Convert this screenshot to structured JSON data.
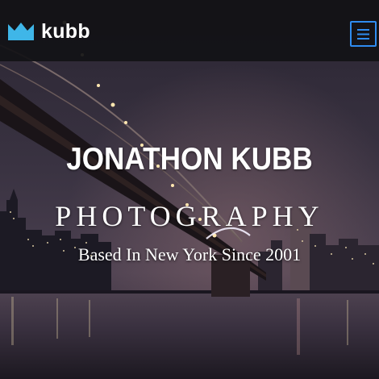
{
  "navbar": {
    "brand_name": "kubb",
    "brand_icon": "crown-icon",
    "menu_icon": "hamburger-menu-icon"
  },
  "hero": {
    "title": "JONATHON KUBB",
    "subtitle": "PHOTOGRAPHY",
    "tagline": "Based In New York Since 2001",
    "background": "night-city-bridge-photo"
  },
  "colors": {
    "brand_accent": "#3fb6e8",
    "menu_border": "#2f8cf0",
    "navbar_bg": "#121216",
    "text": "#ffffff"
  }
}
